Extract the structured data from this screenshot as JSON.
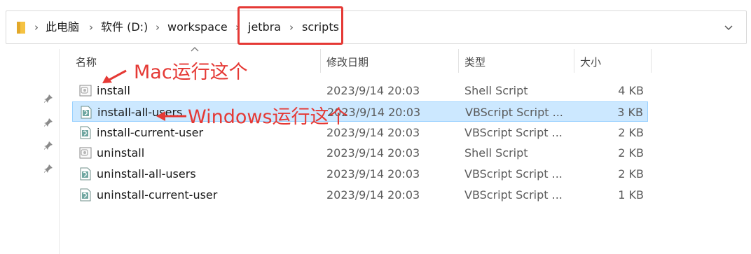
{
  "breadcrumb": {
    "items": [
      "此电脑",
      "软件 (D:)",
      "workspace",
      "jetbra",
      "scripts"
    ]
  },
  "columns": {
    "name": "名称",
    "date": "修改日期",
    "type": "类型",
    "size": "大小"
  },
  "files": [
    {
      "name": "install",
      "date": "2023/9/14 20:03",
      "type": "Shell Script",
      "size": "4 KB",
      "icon": "shell-script-icon",
      "selected": false
    },
    {
      "name": "install-all-users",
      "date": "2023/9/14 20:03",
      "type": "VBScript Script ...",
      "size": "3 KB",
      "icon": "vbscript-icon",
      "selected": true
    },
    {
      "name": "install-current-user",
      "date": "2023/9/14 20:03",
      "type": "VBScript Script ...",
      "size": "2 KB",
      "icon": "vbscript-icon",
      "selected": false
    },
    {
      "name": "uninstall",
      "date": "2023/9/14 20:03",
      "type": "Shell Script",
      "size": "2 KB",
      "icon": "shell-script-icon",
      "selected": false
    },
    {
      "name": "uninstall-all-users",
      "date": "2023/9/14 20:03",
      "type": "VBScript Script ...",
      "size": "2 KB",
      "icon": "vbscript-icon",
      "selected": false
    },
    {
      "name": "uninstall-current-user",
      "date": "2023/9/14 20:03",
      "type": "VBScript Script ...",
      "size": "1 KB",
      "icon": "vbscript-icon",
      "selected": false
    }
  ],
  "annotations": {
    "mac": "Mac运行这个",
    "windows": "Windows运行这个"
  },
  "colors": {
    "annotation": "#e53935",
    "selection": "#cce8ff",
    "selection_border": "#99d1ff"
  }
}
